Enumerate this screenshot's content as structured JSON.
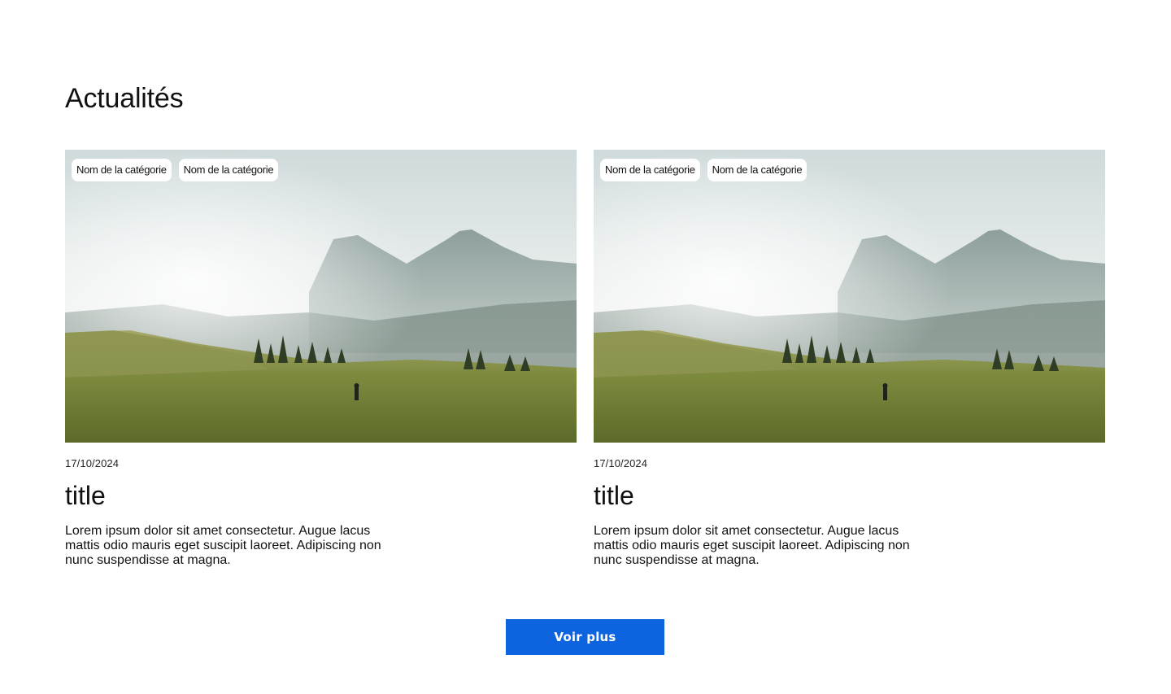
{
  "section": {
    "title": "Actualités"
  },
  "cards": [
    {
      "tags": [
        "Nom de la catégorie",
        "Nom de la catégorie"
      ],
      "date": "17/10/2024",
      "title": "title",
      "description": "Lorem ipsum dolor sit amet consectetur. Augue lacus mattis odio mauris eget suscipit laoreet. Adipiscing non nunc suspendisse at magna."
    },
    {
      "tags": [
        "Nom de la catégorie",
        "Nom de la catégorie"
      ],
      "date": "17/10/2024",
      "title": "title",
      "description": "Lorem ipsum dolor sit amet consectetur. Augue lacus mattis odio mauris eget suscipit laoreet. Adipiscing non nunc suspendisse at magna."
    }
  ],
  "more_button": {
    "label": "Voir plus"
  },
  "colors": {
    "accent": "#0e63df",
    "background": "#ffffff",
    "text": "#111111"
  }
}
